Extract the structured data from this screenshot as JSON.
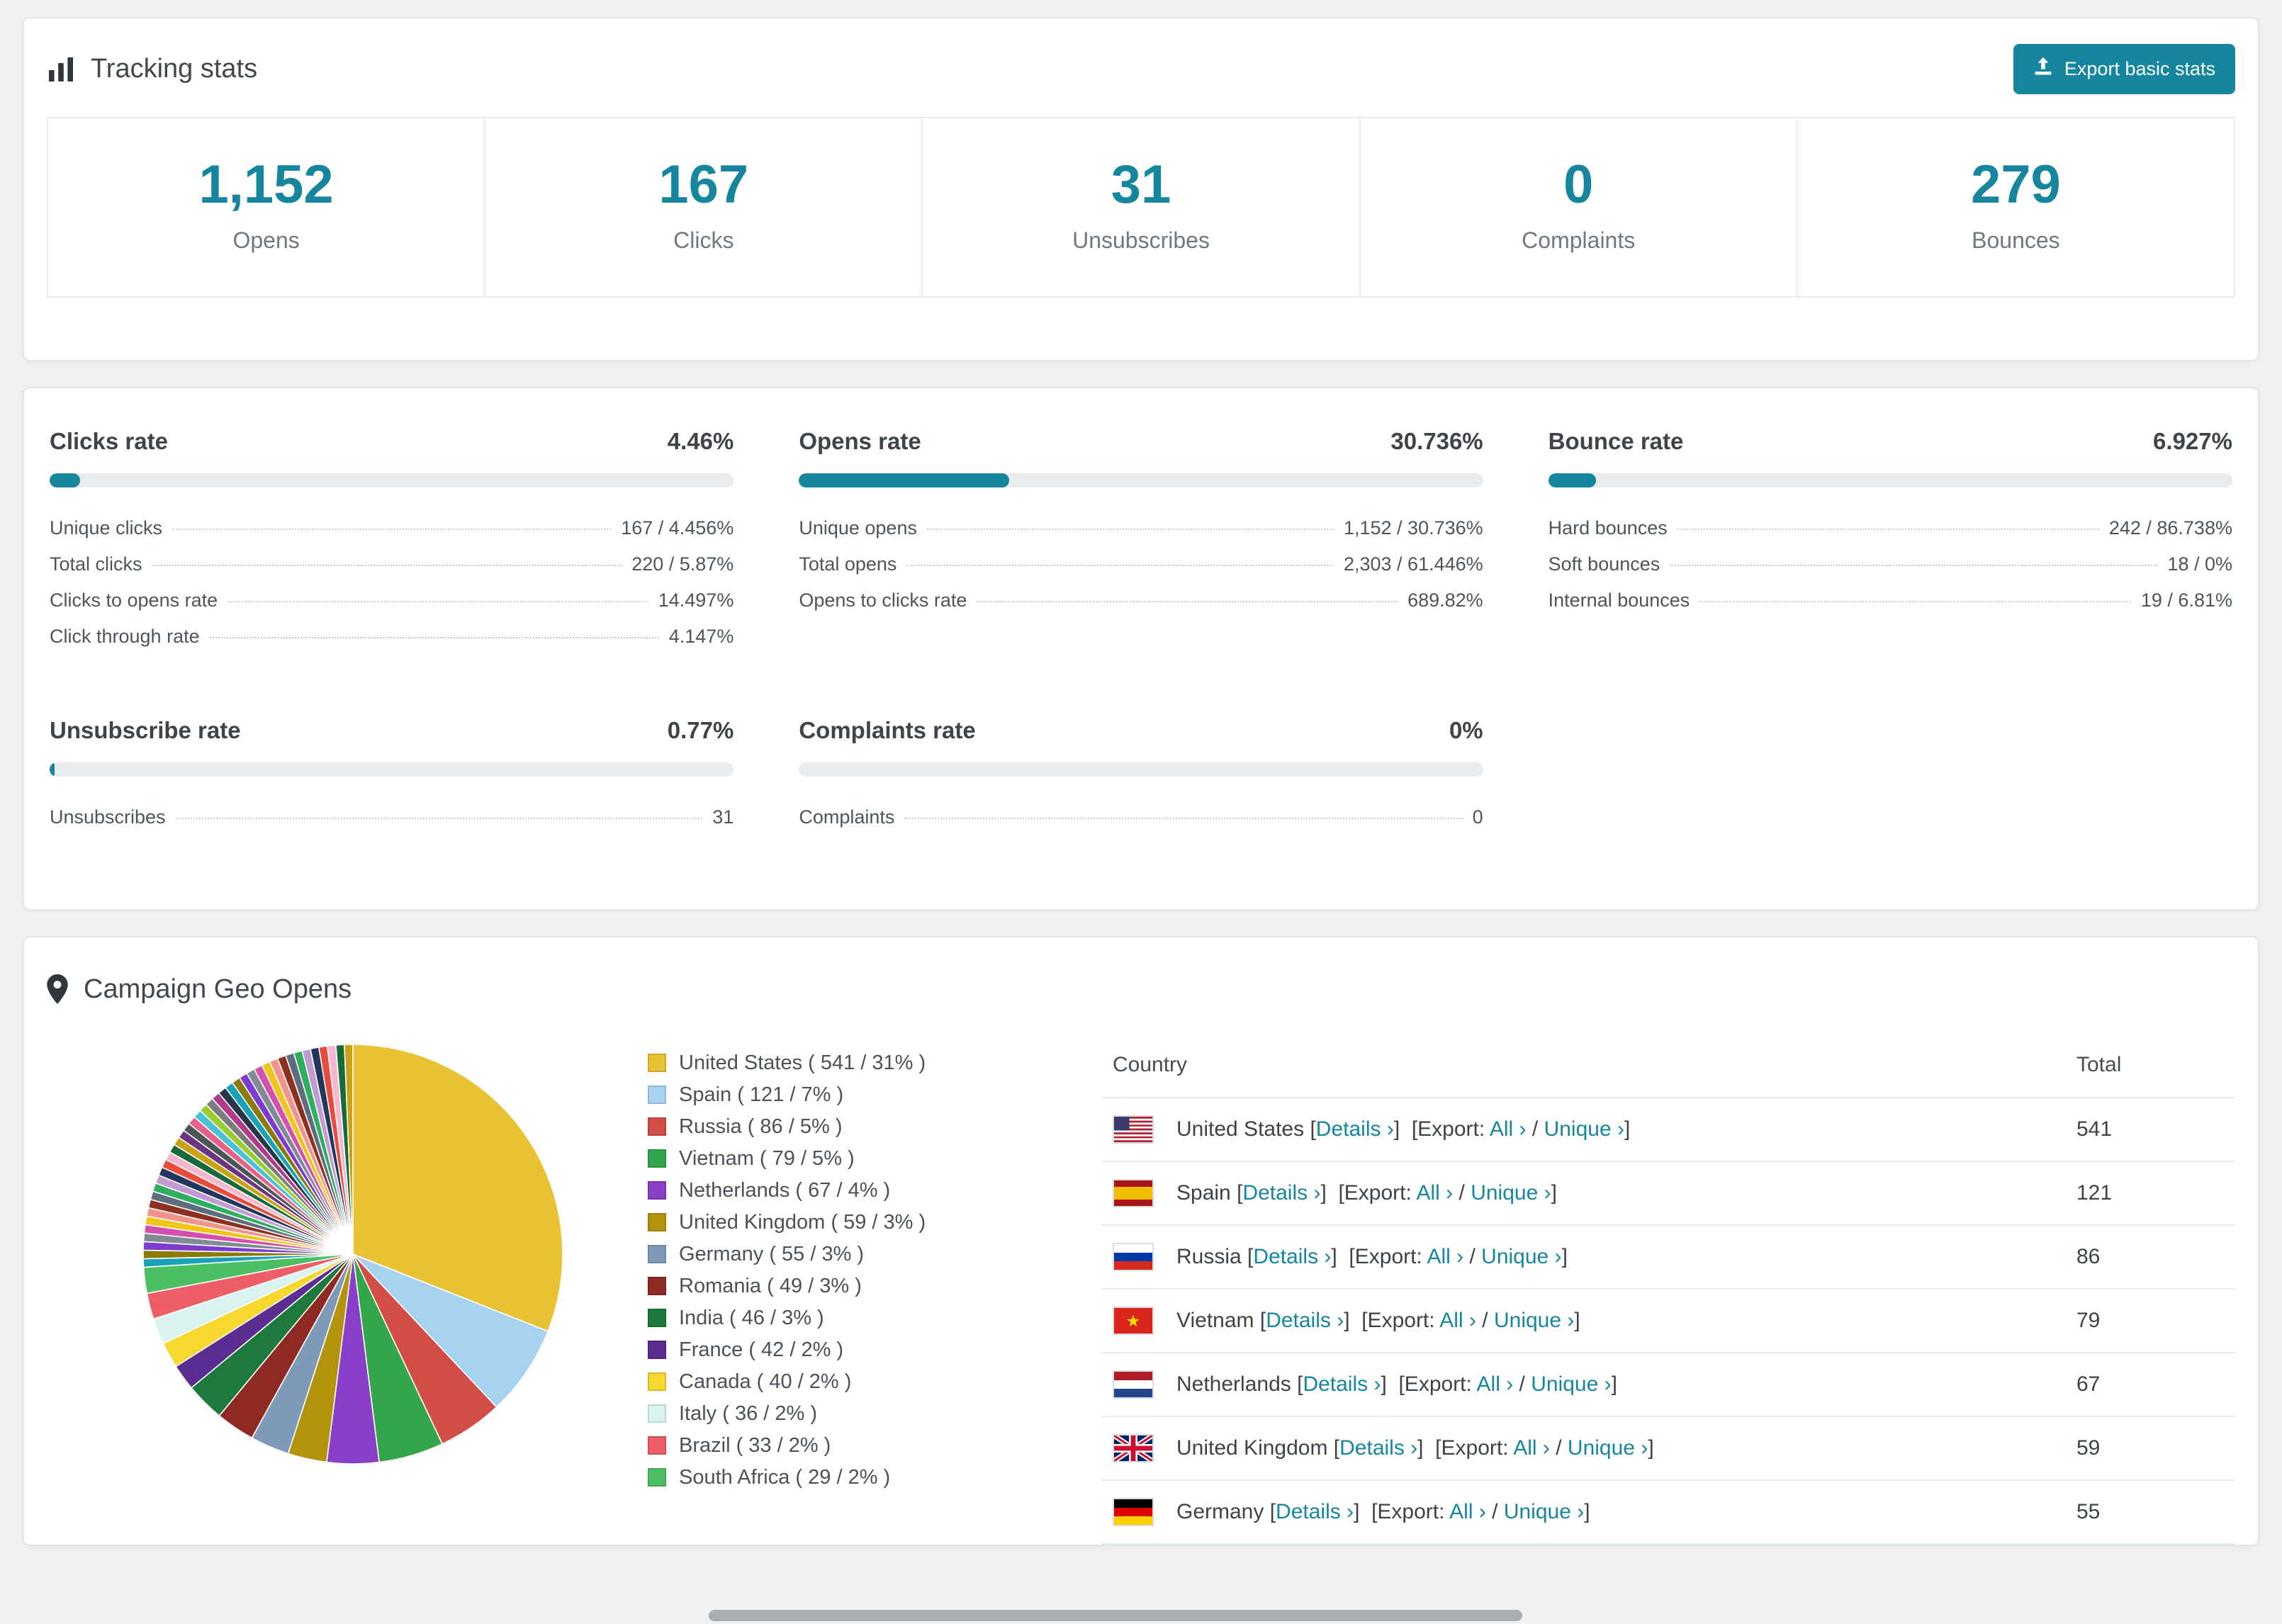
{
  "colors": {
    "accent": "#15869e"
  },
  "tracking_stats": {
    "title": "Tracking stats",
    "export_button": "Export basic stats",
    "stats": [
      {
        "value": "1,152",
        "label": "Opens"
      },
      {
        "value": "167",
        "label": "Clicks"
      },
      {
        "value": "31",
        "label": "Unsubscribes"
      },
      {
        "value": "0",
        "label": "Complaints"
      },
      {
        "value": "279",
        "label": "Bounces"
      }
    ]
  },
  "rates": [
    {
      "title": "Clicks rate",
      "value": "4.46%",
      "percent": 4.46,
      "rows": [
        {
          "label": "Unique clicks",
          "value": "167 / 4.456%"
        },
        {
          "label": "Total clicks",
          "value": "220 / 5.87%"
        },
        {
          "label": "Clicks to opens rate",
          "value": "14.497%"
        },
        {
          "label": "Click through rate",
          "value": "4.147%"
        }
      ]
    },
    {
      "title": "Opens rate",
      "value": "30.736%",
      "percent": 30.736,
      "rows": [
        {
          "label": "Unique opens",
          "value": "1,152 / 30.736%"
        },
        {
          "label": "Total opens",
          "value": "2,303 / 61.446%"
        },
        {
          "label": "Opens to clicks rate",
          "value": "689.82%"
        }
      ]
    },
    {
      "title": "Bounce rate",
      "value": "6.927%",
      "percent": 6.927,
      "rows": [
        {
          "label": "Hard bounces",
          "value": "242 / 86.738%"
        },
        {
          "label": "Soft bounces",
          "value": "18 / 0%"
        },
        {
          "label": "Internal bounces",
          "value": "19 / 6.81%"
        }
      ]
    },
    {
      "title": "Unsubscribe rate",
      "value": "0.77%",
      "percent": 0.77,
      "rows": [
        {
          "label": "Unsubscribes",
          "value": "31"
        }
      ]
    },
    {
      "title": "Complaints rate",
      "value": "0%",
      "percent": 0,
      "rows": [
        {
          "label": "Complaints",
          "value": "0"
        }
      ]
    }
  ],
  "geo": {
    "title": "Campaign Geo Opens",
    "countries": [
      {
        "name": "United States",
        "count": "541",
        "pct": 31,
        "color": "#e9c233"
      },
      {
        "name": "Spain",
        "count": "121",
        "pct": 7,
        "color": "#a7d3f1"
      },
      {
        "name": "Russia",
        "count": "86",
        "pct": 5,
        "color": "#d24d46"
      },
      {
        "name": "Vietnam",
        "count": "79",
        "pct": 5,
        "color": "#33a64c"
      },
      {
        "name": "Netherlands",
        "count": "67",
        "pct": 4,
        "color": "#8a3fc8"
      },
      {
        "name": "United Kingdom",
        "count": "59",
        "pct": 3,
        "color": "#b3930b"
      },
      {
        "name": "Germany",
        "count": "55",
        "pct": 3,
        "color": "#7f9ab8"
      },
      {
        "name": "Romania",
        "count": "49",
        "pct": 3,
        "color": "#8f2a23"
      },
      {
        "name": "India",
        "count": "46",
        "pct": 3,
        "color": "#1e7a3c"
      },
      {
        "name": "France",
        "count": "42",
        "pct": 2,
        "color": "#5b2d90"
      },
      {
        "name": "Canada",
        "count": "40",
        "pct": 2,
        "color": "#f6d830"
      },
      {
        "name": "Italy",
        "count": "36",
        "pct": 2,
        "color": "#d9f4ef"
      },
      {
        "name": "Brazil",
        "count": "33",
        "pct": 2,
        "color": "#ee5e66"
      },
      {
        "name": "South Africa",
        "count": "29",
        "pct": 2,
        "color": "#4cbf63"
      }
    ],
    "chart_others": {
      "count": 40,
      "percent_each": 0.65,
      "palette": [
        "#18a2b8",
        "#8a7a06",
        "#7d3bd0",
        "#808b96",
        "#d44fae",
        "#f0c419",
        "#f1948a",
        "#8e3020",
        "#5d6d7e",
        "#2eae60",
        "#c39bd3",
        "#23365e",
        "#e74c3c",
        "#f5b7d0",
        "#186a3b",
        "#c8a415",
        "#6c3483",
        "#4d5656",
        "#e6608a",
        "#49c3d4",
        "#9acd32",
        "#7b7d7d",
        "#b03a8c",
        "#283747"
      ]
    },
    "table": {
      "headers": [
        "Country",
        "Total"
      ],
      "labels": {
        "details": "Details",
        "export": "Export:",
        "all": "All",
        "unique": "Unique"
      },
      "rows": [
        {
          "flag": "us",
          "country": "United States",
          "total": "541"
        },
        {
          "flag": "es",
          "country": "Spain",
          "total": "121"
        },
        {
          "flag": "ru",
          "country": "Russia",
          "total": "86"
        },
        {
          "flag": "vn",
          "country": "Vietnam",
          "total": "79"
        },
        {
          "flag": "nl",
          "country": "Netherlands",
          "total": "67"
        },
        {
          "flag": "gb",
          "country": "United Kingdom",
          "total": "59"
        },
        {
          "flag": "de",
          "country": "Germany",
          "total": "55"
        }
      ]
    }
  },
  "chart_data": {
    "type": "pie",
    "title": "Campaign Geo Opens",
    "labels": [
      "United States",
      "Spain",
      "Russia",
      "Vietnam",
      "Netherlands",
      "United Kingdom",
      "Germany",
      "Romania",
      "India",
      "France",
      "Canada",
      "Italy",
      "Brazil",
      "South Africa"
    ],
    "values": [
      541,
      121,
      86,
      79,
      67,
      59,
      55,
      49,
      46,
      42,
      40,
      36,
      33,
      29
    ],
    "percents": [
      31,
      7,
      5,
      5,
      4,
      3,
      3,
      3,
      3,
      2,
      2,
      2,
      2,
      2
    ],
    "legend_position": "right",
    "note": "remaining ~26% of pie is many small unlabeled country slices"
  }
}
